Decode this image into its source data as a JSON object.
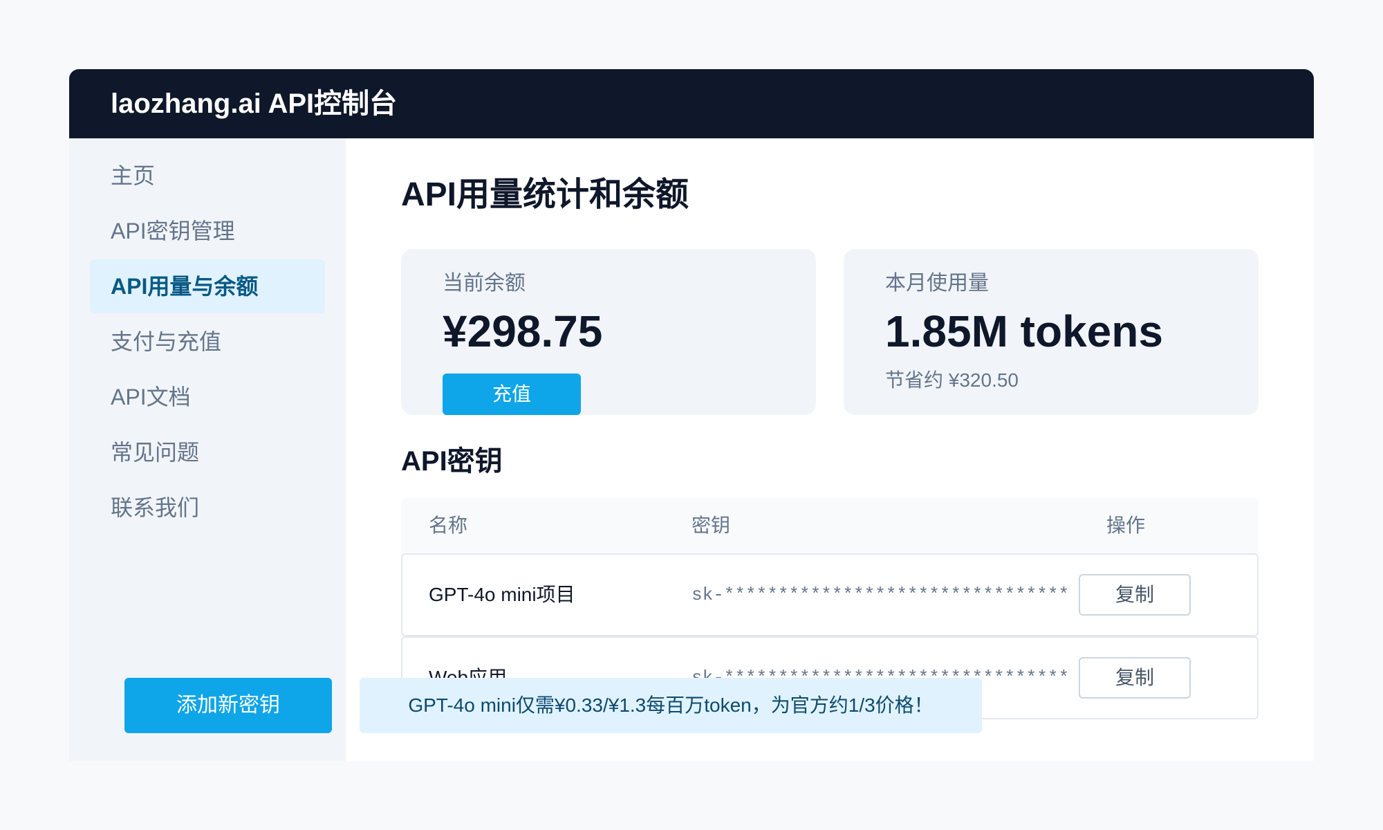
{
  "header": {
    "title": "laozhang.ai API控制台"
  },
  "sidebar": {
    "items": [
      {
        "label": "主页"
      },
      {
        "label": "API密钥管理"
      },
      {
        "label": "API用量与余额"
      },
      {
        "label": "支付与充值"
      },
      {
        "label": "API文档"
      },
      {
        "label": "常见问题"
      },
      {
        "label": "联系我们"
      }
    ],
    "active_index": 2
  },
  "main": {
    "title": "API用量统计和余额",
    "balance_card": {
      "label": "当前余额",
      "value": "¥298.75",
      "button_label": "充值"
    },
    "usage_card": {
      "label": "本月使用量",
      "value": "1.85M tokens",
      "savings": "节省约 ¥320.50"
    },
    "keys_section": {
      "title": "API密钥",
      "columns": [
        "名称",
        "密钥",
        "操作"
      ],
      "rows": [
        {
          "name": "GPT-4o mini项目",
          "key": "sk-********************************",
          "action": "复制"
        },
        {
          "name": "Web应用",
          "key": "sk-********************************",
          "action": "复制"
        }
      ]
    },
    "add_key_label": "添加新密钥",
    "promo_text": "GPT-4o mini仅需¥0.33/¥1.3每百万token，为官方约1/3价格！"
  },
  "colors": {
    "topbar": "#0f172a",
    "accent": "#0ea5e9",
    "active_nav_bg": "#e0f2fe",
    "active_nav_text": "#075985"
  }
}
